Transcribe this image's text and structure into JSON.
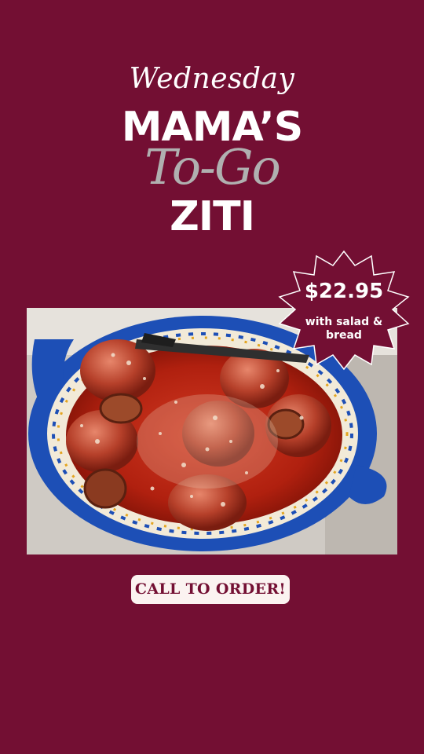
{
  "promo": {
    "day": "Wednesday",
    "title_line1": "MAMA’S",
    "title_line2": "To-Go",
    "title_line3": "ZITI"
  },
  "price_badge": {
    "price": "$22.95",
    "note": "with salad & bread"
  },
  "cta": {
    "label": "CALL TO ORDER!"
  },
  "colors": {
    "background": "#730f33",
    "badge": "#730f33",
    "script_gray": "#b0b0b0",
    "cta_bg": "#fbf3f1"
  }
}
